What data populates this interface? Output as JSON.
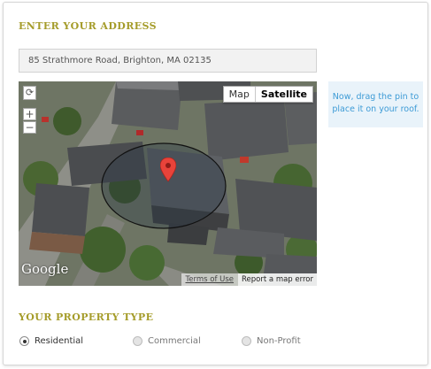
{
  "address": {
    "title": "ENTER YOUR ADDRESS",
    "value": "85 Strathmore Road, Brighton, MA 02135"
  },
  "map": {
    "type_map": "Map",
    "type_satellite": "Satellite",
    "selected_type": "Satellite",
    "rotate_icon": "⟳",
    "zoom_in": "+",
    "zoom_out": "−",
    "logo": "Google",
    "terms": "Terms of Use",
    "report": "Report a map error",
    "pin_color": "#e8433a"
  },
  "hint": {
    "text": "Now, drag the pin to place it on your roof."
  },
  "property": {
    "title": "YOUR PROPERTY TYPE",
    "options": [
      {
        "label": "Residential",
        "selected": true
      },
      {
        "label": "Commercial",
        "selected": false
      },
      {
        "label": "Non-Profit",
        "selected": false
      }
    ]
  },
  "colors": {
    "heading": "#a59c2a",
    "hint_bg": "#e9f3fa",
    "hint_text": "#3d9bd6"
  }
}
